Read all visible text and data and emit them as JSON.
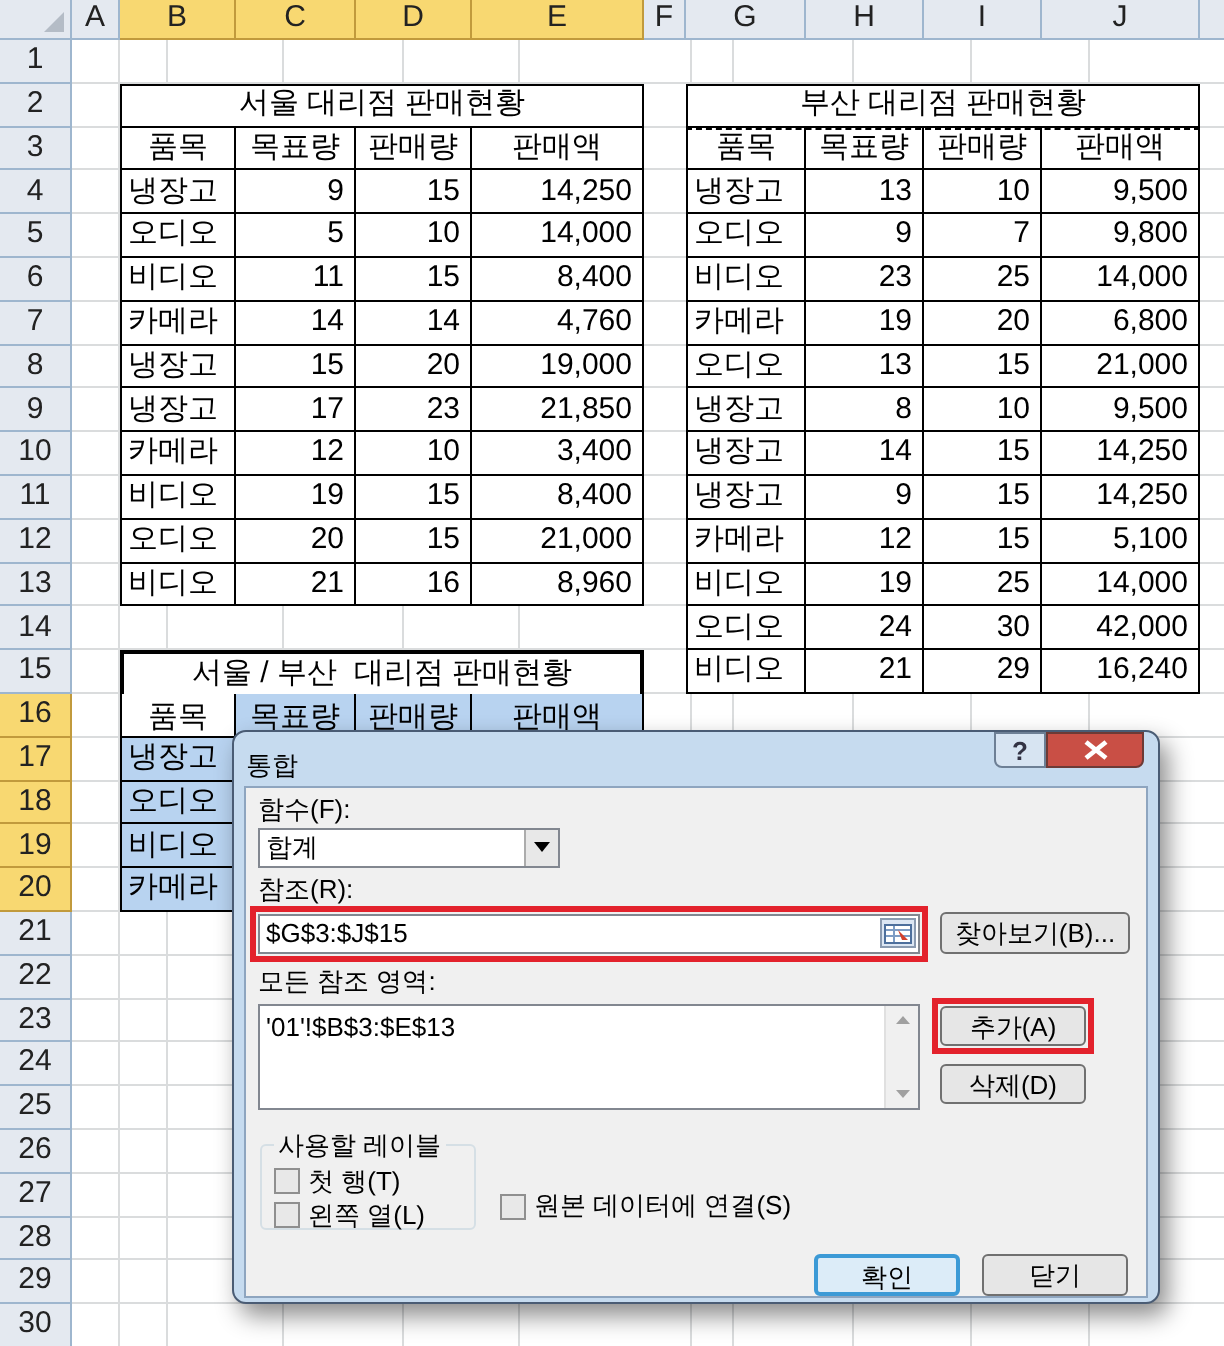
{
  "column_headers": [
    {
      "label": "A",
      "selected": false
    },
    {
      "label": "B",
      "selected": true
    },
    {
      "label": "C",
      "selected": true
    },
    {
      "label": "D",
      "selected": true
    },
    {
      "label": "E",
      "selected": true
    },
    {
      "label": "F",
      "selected": false
    },
    {
      "label": "G",
      "selected": false
    },
    {
      "label": "H",
      "selected": false
    },
    {
      "label": "I",
      "selected": false
    },
    {
      "label": "J",
      "selected": false
    }
  ],
  "row_headers": [
    {
      "label": "1",
      "selected": false
    },
    {
      "label": "2",
      "selected": false
    },
    {
      "label": "3",
      "selected": false
    },
    {
      "label": "4",
      "selected": false
    },
    {
      "label": "5",
      "selected": false
    },
    {
      "label": "6",
      "selected": false
    },
    {
      "label": "7",
      "selected": false
    },
    {
      "label": "8",
      "selected": false
    },
    {
      "label": "9",
      "selected": false
    },
    {
      "label": "10",
      "selected": false
    },
    {
      "label": "11",
      "selected": false
    },
    {
      "label": "12",
      "selected": false
    },
    {
      "label": "13",
      "selected": false
    },
    {
      "label": "14",
      "selected": false
    },
    {
      "label": "15",
      "selected": false
    },
    {
      "label": "16",
      "selected": true
    },
    {
      "label": "17",
      "selected": true
    },
    {
      "label": "18",
      "selected": true
    },
    {
      "label": "19",
      "selected": true
    },
    {
      "label": "20",
      "selected": true
    },
    {
      "label": "21",
      "selected": false
    },
    {
      "label": "22",
      "selected": false
    },
    {
      "label": "23",
      "selected": false
    },
    {
      "label": "24",
      "selected": false
    },
    {
      "label": "25",
      "selected": false
    },
    {
      "label": "26",
      "selected": false
    },
    {
      "label": "27",
      "selected": false
    },
    {
      "label": "28",
      "selected": false
    },
    {
      "label": "29",
      "selected": false
    },
    {
      "label": "30",
      "selected": false
    }
  ],
  "seoul_table": {
    "title": "서울 대리점 판매현황",
    "columns": [
      "품목",
      "목표량",
      "판매량",
      "판매액"
    ],
    "rows": [
      [
        "냉장고",
        "9",
        "15",
        "14,250"
      ],
      [
        "오디오",
        "5",
        "10",
        "14,000"
      ],
      [
        "비디오",
        "11",
        "15",
        "8,400"
      ],
      [
        "카메라",
        "14",
        "14",
        "4,760"
      ],
      [
        "냉장고",
        "15",
        "20",
        "19,000"
      ],
      [
        "냉장고",
        "17",
        "23",
        "21,850"
      ],
      [
        "카메라",
        "12",
        "10",
        "3,400"
      ],
      [
        "비디오",
        "19",
        "15",
        "8,400"
      ],
      [
        "오디오",
        "20",
        "15",
        "21,000"
      ],
      [
        "비디오",
        "21",
        "16",
        "8,960"
      ]
    ]
  },
  "busan_table": {
    "title": "부산 대리점 판매현황",
    "marquee": true,
    "columns": [
      "품목",
      "목표량",
      "판매량",
      "판매액"
    ],
    "rows": [
      [
        "냉장고",
        "13",
        "10",
        "9,500"
      ],
      [
        "오디오",
        "9",
        "7",
        "9,800"
      ],
      [
        "비디오",
        "23",
        "25",
        "14,000"
      ],
      [
        "카메라",
        "19",
        "20",
        "6,800"
      ],
      [
        "오디오",
        "13",
        "15",
        "21,000"
      ],
      [
        "냉장고",
        "8",
        "10",
        "9,500"
      ],
      [
        "냉장고",
        "14",
        "15",
        "14,250"
      ],
      [
        "냉장고",
        "9",
        "15",
        "14,250"
      ],
      [
        "카메라",
        "12",
        "15",
        "5,100"
      ],
      [
        "비디오",
        "19",
        "25",
        "14,000"
      ],
      [
        "오디오",
        "24",
        "30",
        "42,000"
      ],
      [
        "비디오",
        "21",
        "29",
        "16,240"
      ]
    ]
  },
  "summary_table": {
    "title": "서울 / 부산  대리점 판매현황",
    "columns": [
      {
        "label": "품목",
        "selected": false
      },
      {
        "label": "목표량",
        "selected": true
      },
      {
        "label": "판매량",
        "selected": true
      },
      {
        "label": "판매액",
        "selected": true
      }
    ],
    "rows": [
      {
        "label": "냉장고",
        "selected": true
      },
      {
        "label": "오디오",
        "selected": true
      },
      {
        "label": "비디오",
        "selected": true
      },
      {
        "label": "카메라",
        "selected": true
      }
    ]
  },
  "dialog": {
    "title": "통합",
    "help_button": "?",
    "function": {
      "label": "함수(F):",
      "value": "합계"
    },
    "reference": {
      "label": "참조(R):",
      "value": "$G$3:$J$15",
      "highlighted": true
    },
    "browse_button": "찾아보기(B)...",
    "all_references": {
      "label": "모든 참조 영역:",
      "items": [
        "'01'!$B$3:$E$13"
      ]
    },
    "add_button": {
      "label": "추가(A)",
      "highlighted": true
    },
    "delete_button": "삭제(D)",
    "use_labels": {
      "title": "사용할 레이블",
      "options": [
        {
          "label": "첫 행(T)",
          "checked": false
        },
        {
          "label": "왼쪽 열(L)",
          "checked": false
        }
      ]
    },
    "link_source": {
      "label": "원본 데이터에 연결(S)",
      "checked": false
    },
    "ok_button": {
      "label": "확인",
      "default": true
    },
    "close_button": "닫기"
  }
}
